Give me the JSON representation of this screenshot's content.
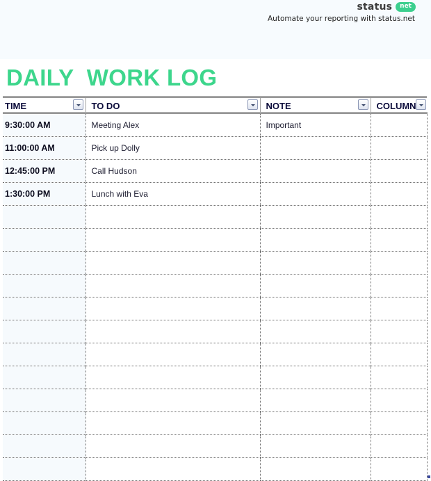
{
  "brand": {
    "word": "status",
    "pill": "net",
    "tagline": "Automate your reporting with status.net",
    "accent_color": "#3ccf8e"
  },
  "title": "DAILY  WORK LOG",
  "title_color": "#3dd68c",
  "table": {
    "columns": [
      {
        "label": "TIME",
        "filter_icon": "dropdown-filter-icon"
      },
      {
        "label": "TO DO",
        "filter_icon": "dropdown-filter-icon"
      },
      {
        "label": "NOTE",
        "filter_icon": "dropdown-filter-icon"
      },
      {
        "label": "COLUMN",
        "filter_icon": "dropdown-filter-icon"
      }
    ],
    "rows": [
      {
        "time": "9:30:00 AM",
        "todo": "Meeting Alex",
        "note": "Important",
        "extra": ""
      },
      {
        "time": "11:00:00 AM",
        "todo": "Pick up Dolly",
        "note": "",
        "extra": ""
      },
      {
        "time": "12:45:00 PM",
        "todo": "Call Hudson",
        "note": "",
        "extra": ""
      },
      {
        "time": "1:30:00 PM",
        "todo": "Lunch with Eva",
        "note": "",
        "extra": ""
      },
      {
        "time": "",
        "todo": "",
        "note": "",
        "extra": ""
      },
      {
        "time": "",
        "todo": "",
        "note": "",
        "extra": ""
      },
      {
        "time": "",
        "todo": "",
        "note": "",
        "extra": ""
      },
      {
        "time": "",
        "todo": "",
        "note": "",
        "extra": ""
      },
      {
        "time": "",
        "todo": "",
        "note": "",
        "extra": ""
      },
      {
        "time": "",
        "todo": "",
        "note": "",
        "extra": ""
      },
      {
        "time": "",
        "todo": "",
        "note": "",
        "extra": ""
      },
      {
        "time": "",
        "todo": "",
        "note": "",
        "extra": ""
      },
      {
        "time": "",
        "todo": "",
        "note": "",
        "extra": ""
      },
      {
        "time": "",
        "todo": "",
        "note": "",
        "extra": ""
      },
      {
        "time": "",
        "todo": "",
        "note": "",
        "extra": ""
      },
      {
        "time": "",
        "todo": "",
        "note": "",
        "extra": ""
      }
    ]
  }
}
